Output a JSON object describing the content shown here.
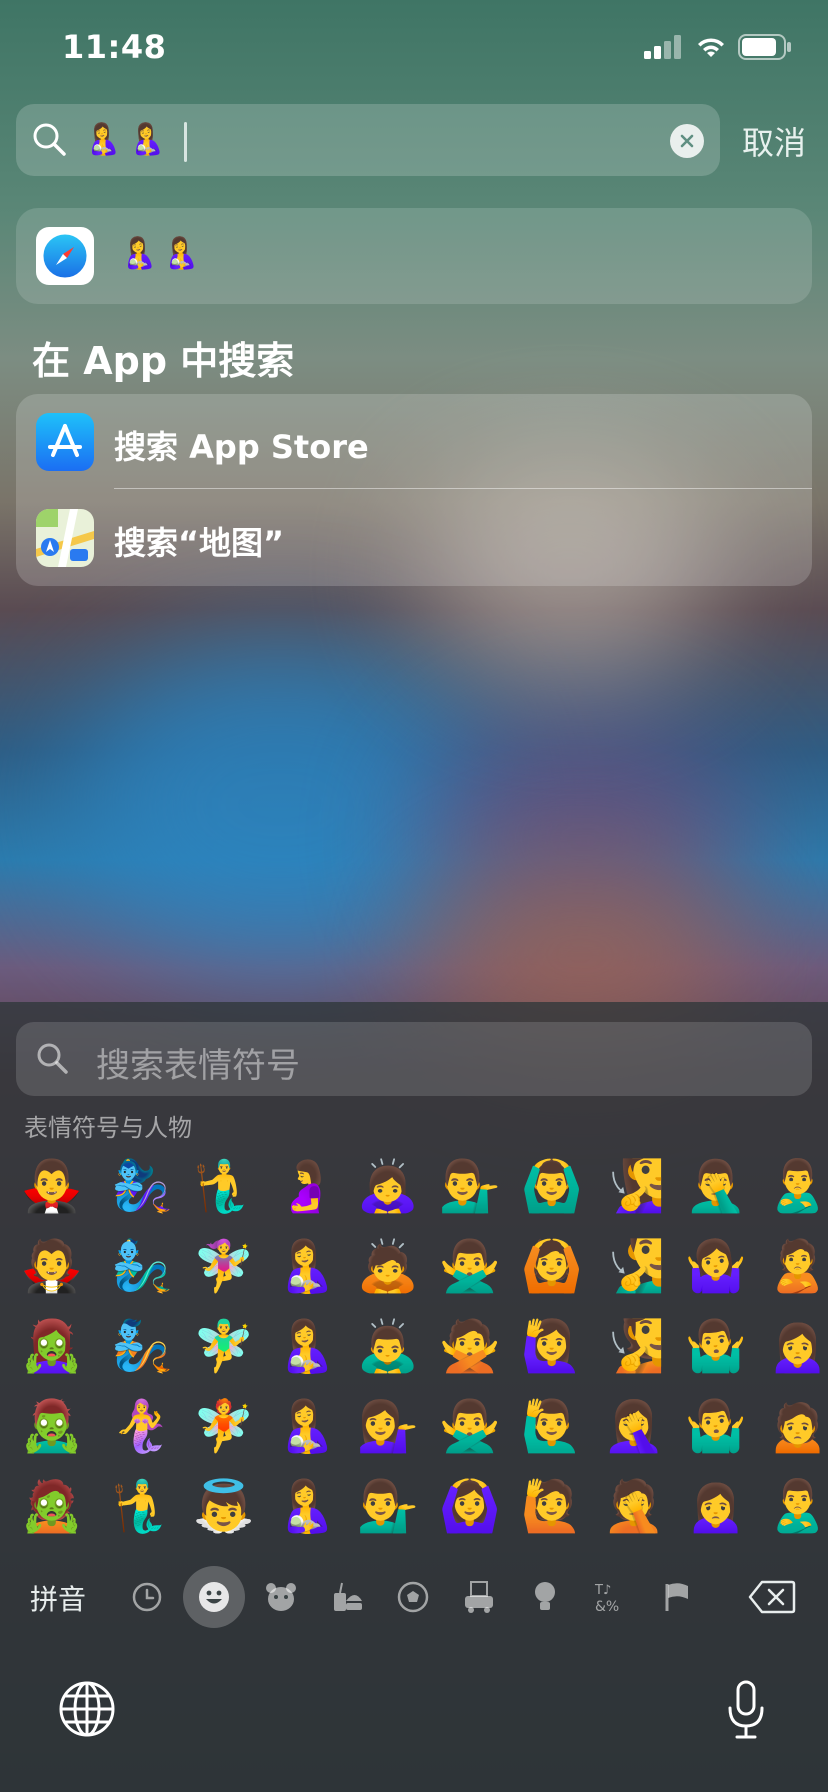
{
  "status_bar": {
    "time": "11:48",
    "icons": [
      "cellular-signal-icon",
      "wifi-icon",
      "battery-icon"
    ]
  },
  "search": {
    "query_tokens": [
      "🤱",
      "🤱"
    ],
    "clear_icon": "clear-icon",
    "cancel_label": "取消"
  },
  "suggestion": {
    "app_icon": "safari-icon",
    "text_tokens": [
      "🤱",
      "🤱"
    ]
  },
  "section": {
    "title": "在 App 中搜索"
  },
  "search_in_apps": [
    {
      "icon": "app-store-icon",
      "label": "搜索 App Store"
    },
    {
      "icon": "maps-icon",
      "label": "搜索“地图”"
    }
  ],
  "emoji_keyboard": {
    "search_placeholder": "搜索表情符号",
    "category_label": "表情符号与人物",
    "emoji_rows": [
      [
        "🧛‍♂️",
        "🧞‍♀️",
        "🧜‍♂️",
        "🤰",
        "🙇‍♀️",
        "💁‍♂️",
        "🙆‍♂️",
        "🧏‍♀️",
        "🤦‍♂️",
        "🙎‍♂️"
      ],
      [
        "🧛",
        "🧞‍♂️",
        "🧚‍♀️",
        "🤱",
        "🙇",
        "🙅‍♂️",
        "🙆",
        "🧏‍♂️",
        "🤷‍♀️",
        "🙎"
      ],
      [
        "🧟‍♀️",
        "🧞",
        "🧚‍♂️",
        "🤱",
        "🙇‍♂️",
        "🙅",
        "🙋‍♀️",
        "🧏",
        "🤷‍♂️",
        "🙍‍♀️"
      ],
      [
        "🧟‍♂️",
        "🧜‍♀️",
        "🧚",
        "🤱",
        "💁‍♀️",
        "🙅‍♂️",
        "🙋‍♂️",
        "🤦‍♀️",
        "🤷‍♂️",
        "🙍"
      ],
      [
        "🧟",
        "🧜‍♂️",
        "👼",
        "🤱",
        "💁‍♂️",
        "🙆‍♀️",
        "🙋",
        "🤦",
        "🙍‍♀️",
        "🙎‍♂️"
      ]
    ],
    "pinyin_label": "拼音",
    "categories": [
      "recent-icon",
      "smiley-icon",
      "animal-icon",
      "food-icon",
      "sports-icon",
      "travel-icon",
      "objects-icon",
      "symbols-icon",
      "flag-icon"
    ],
    "active_category": "smiley-icon",
    "delete_icon": "delete-icon",
    "globe_icon": "globe-icon",
    "mic_icon": "microphone-icon"
  },
  "colors": {
    "accent": "#2d86c2",
    "keyboard_bg": "#30373a"
  }
}
